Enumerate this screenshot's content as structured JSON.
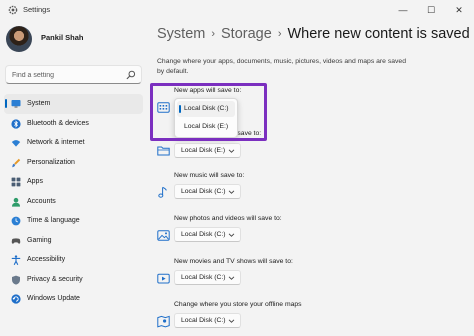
{
  "window": {
    "title": "Settings",
    "minimize_glyph": "—",
    "maximize_glyph": "☐",
    "close_glyph": "✕"
  },
  "profile": {
    "name": "Pankil Shah"
  },
  "search": {
    "placeholder": "Find a setting"
  },
  "sidebar": {
    "items": [
      {
        "label": "System",
        "icon": "monitor-icon",
        "active": true
      },
      {
        "label": "Bluetooth & devices",
        "icon": "bluetooth-icon"
      },
      {
        "label": "Network & internet",
        "icon": "wifi-icon"
      },
      {
        "label": "Personalization",
        "icon": "paintbrush-icon"
      },
      {
        "label": "Apps",
        "icon": "apps-grid-icon"
      },
      {
        "label": "Accounts",
        "icon": "person-icon"
      },
      {
        "label": "Time & language",
        "icon": "globe-clock-icon"
      },
      {
        "label": "Gaming",
        "icon": "gamepad-icon"
      },
      {
        "label": "Accessibility",
        "icon": "accessibility-icon"
      },
      {
        "label": "Privacy & security",
        "icon": "shield-icon"
      },
      {
        "label": "Windows Update",
        "icon": "update-icon"
      }
    ]
  },
  "breadcrumb": {
    "items": [
      "System",
      "Storage",
      "Where new content is saved"
    ],
    "separator": "›"
  },
  "main": {
    "description": "Change where your apps, documents, music, pictures, videos and maps are saved by default.",
    "settings": [
      {
        "label": "New apps will save to:",
        "value": "Local Disk (C:)",
        "icon": "app-window-icon"
      },
      {
        "label": "New documents will save to:",
        "value": "Local Disk (E:)",
        "icon": "folder-icon"
      },
      {
        "label": "New music will save to:",
        "value": "Local Disk (C:)",
        "icon": "music-note-icon"
      },
      {
        "label": "New photos and videos will save to:",
        "value": "Local Disk (C:)",
        "icon": "picture-icon"
      },
      {
        "label": "New movies and TV shows will save to:",
        "value": "Local Disk (C:)",
        "icon": "movie-icon"
      },
      {
        "label": "Change where you store your offline maps",
        "value": "Local Disk (C:)",
        "icon": "map-icon"
      }
    ],
    "overlapped_label_fragment": "l save to:",
    "popup": {
      "options": [
        "Local Disk (C:)",
        "Local Disk (E:)"
      ],
      "selected": "Local Disk (C:)"
    }
  },
  "colors": {
    "accent": "#0067c0",
    "highlight_border": "#7b2fbf",
    "background": "#f3f3f3"
  }
}
